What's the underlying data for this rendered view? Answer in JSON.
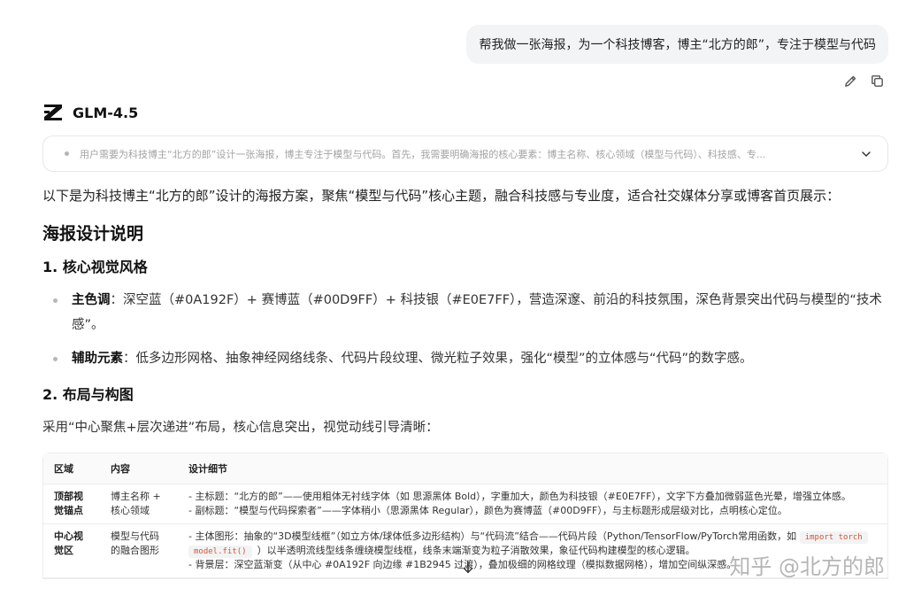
{
  "user_message": "帮我做一张海报，为一个科技博客，博主“北方的郎”，专注于模型与代码",
  "actions": {
    "edit_icon": "pencil-icon",
    "copy_icon": "copy-icon"
  },
  "model": {
    "name": "GLM-4.5",
    "logo_icon": "z-logo-icon"
  },
  "thinking": {
    "text": "用户需要为科技博主“北方的郎”设计一张海报，博主专注于模型与代码。首先，我需要明确海报的核心要素：博主名称、核心领域（模型与代码）、科技感、专...",
    "toggle_icon": "chevron-down-icon"
  },
  "response": {
    "intro": "以下是为科技博主“北方的郎”设计的海报方案，聚焦“模型与代码”核心主题，融合科技感与专业度，适合社交媒体分享或博客首页展示：",
    "h2": "海报设计说明",
    "section1": {
      "title": "1. 核心视觉风格",
      "bullets": [
        {
          "label": "主色调",
          "text": "：深空蓝（#0A192F）+ 赛博蓝（#00D9FF）+ 科技银（#E0E7FF），营造深邃、前沿的科技氛围，深色背景突出代码与模型的“技术感”。"
        },
        {
          "label": "辅助元素",
          "text": "：低多边形网格、抽象神经网络线条、代码片段纹理、微光粒子效果，强化“模型”的立体感与“代码”的数字感。"
        }
      ]
    },
    "section2": {
      "title": "2. 布局与构图",
      "para": "采用“中心聚焦+层次递进”布局，核心信息突出，视觉动线引导清晰：",
      "table": {
        "headers": [
          "区域",
          "内容",
          "设计细节"
        ],
        "rows": [
          {
            "area": "顶部视觉锚点",
            "content": "博主名称 + 核心领域",
            "lines": [
              "- 主标题：“北方的郎”——使用粗体无衬线字体（如 思源黑体 Bold），字重加大，颜色为科技银（#E0E7FF），文字下方叠加微弱蓝色光晕，增强立体感。",
              "- 副标题：“模型与代码探索者”——字体稍小（思源黑体 Regular），颜色为赛博蓝（#00D9FF），与主标题形成层级对比，点明核心定位。"
            ]
          },
          {
            "area": "中心视觉区",
            "content": "模型与代码的融合图形",
            "line1": "- 主体图形：抽象的“3D模型线框”（如立方体/球体低多边形结构）与“代码流”结合——代码片段（Python/TensorFlow/PyTorch常用函数，如",
            "code1": "import torch",
            "code2": "model.fit()",
            "line2": "）以半透明流线型线条缠绕模型线框，线条末端渐变为粒子消散效果，象征代码构建模型的核心逻辑。",
            "line3": "- 背景层：深空蓝渐变（从中心 #0A192F 向边缘 #1B2945 过渡），叠加极细的网格纹理（模拟数据网格），增加空间纵深感。"
          }
        ]
      }
    }
  },
  "watermark": "知乎 @北方的郎"
}
